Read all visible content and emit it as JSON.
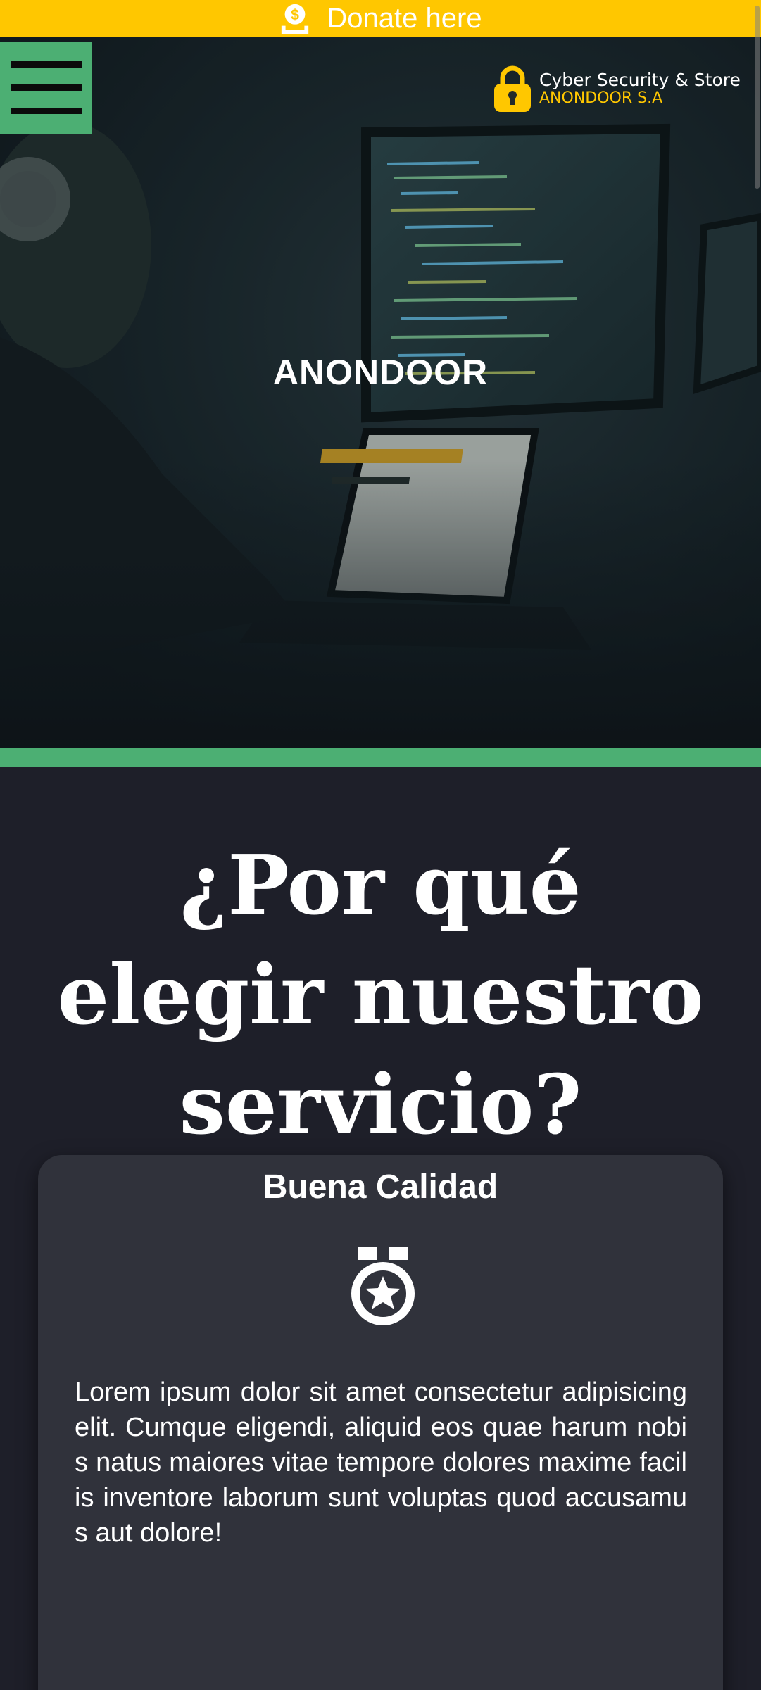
{
  "donate_bar": {
    "label": "Donate here",
    "icon": "donate-money-icon",
    "background": "#ffc700"
  },
  "header": {
    "menu_icon": "hamburger-menu-icon",
    "menu_color": "#4caf73",
    "logo": {
      "icon": "padlock-icon",
      "line1": "Cyber Security & Store",
      "line2": "ANONDOOR S.A"
    }
  },
  "hero": {
    "title": "ANONDOOR"
  },
  "why_section": {
    "title": "¿Por qué elegir nuestro servicio?",
    "cards": [
      {
        "title": "Buena Calidad",
        "icon": "medal-star-icon",
        "text": "Lorem ipsum dolor sit amet consectetur adipisicing elit. Cumque eligendi, aliquid eos quae harum nobis natus maiores vitae tempore dolores maxime facilis inventore laborum sunt voluptas quod accusamus aut dolore!"
      }
    ]
  },
  "colors": {
    "accent_green": "#4caf73",
    "accent_yellow": "#ffc700",
    "page_background": "#1e1f29",
    "card_background": "#30323b"
  }
}
